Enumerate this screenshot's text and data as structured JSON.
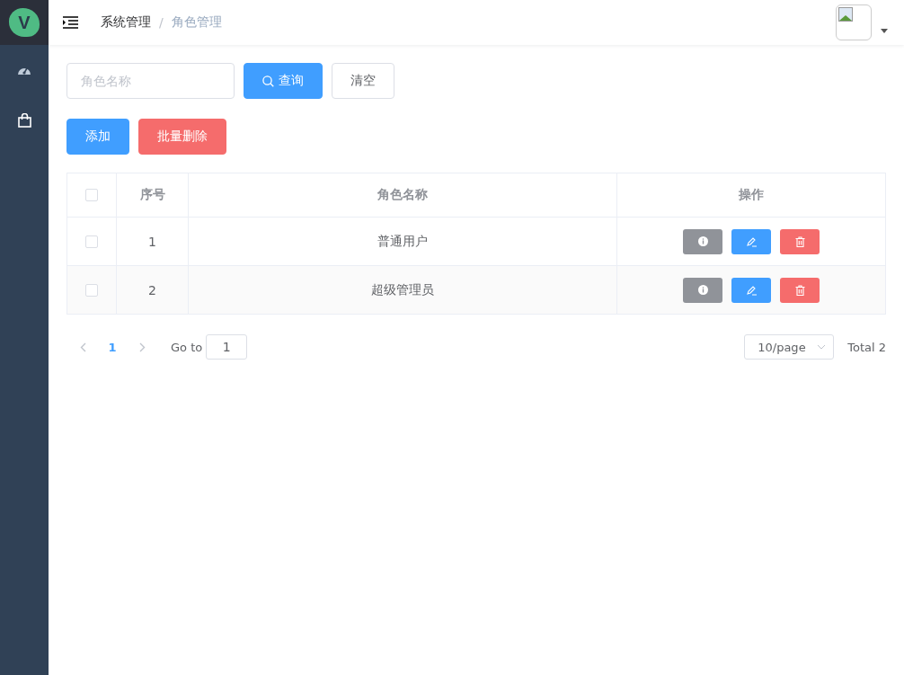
{
  "logo": {
    "letter": "V"
  },
  "breadcrumb": [
    "系统管理",
    "角色管理"
  ],
  "breadcrumb_separator": "/",
  "search": {
    "placeholder": "角色名称",
    "query_button": "查询",
    "clear_button": "清空"
  },
  "actions": {
    "add_button": "添加",
    "batch_delete_button": "批量删除"
  },
  "table": {
    "select_all": {
      "checked": false
    },
    "columns": [
      "序号",
      "角色名称",
      "操作"
    ],
    "rows": [
      {
        "checked": false,
        "index": "1",
        "name": "普通用户"
      },
      {
        "checked": false,
        "index": "2",
        "name": "超级管理员"
      }
    ]
  },
  "pagination": {
    "pages": [
      {
        "label": "1",
        "selected": true
      }
    ],
    "goto_label": "Go to",
    "goto_value": "1",
    "page_size": "10/page",
    "total": "Total 2"
  }
}
